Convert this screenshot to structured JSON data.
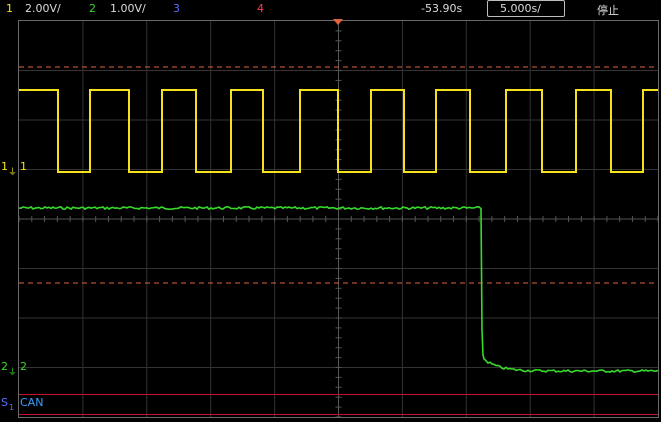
{
  "header": {
    "ch1_num": "1",
    "ch1_scale": "2.00V/",
    "ch2_num": "2",
    "ch2_scale": "1.00V/",
    "ch3_num": "3",
    "ch4_num": "4",
    "trigger_delay": "-53.90s",
    "timebase": "5.000s/",
    "run_state": "停止"
  },
  "screen": {
    "ch1_marker": "1",
    "ch1_marker_left": "1",
    "ch2_marker": "2",
    "ch2_marker_left": "2",
    "serial_label": "S",
    "serial_sub": "1",
    "serial_protocol": "CAN"
  },
  "colors": {
    "ch1": "#f5e21b",
    "ch2": "#37d92b",
    "ch3": "#5a6dff",
    "ch4": "#ff3b4b",
    "grid": "#3c3c3c",
    "cursor": "#e0643c"
  }
}
